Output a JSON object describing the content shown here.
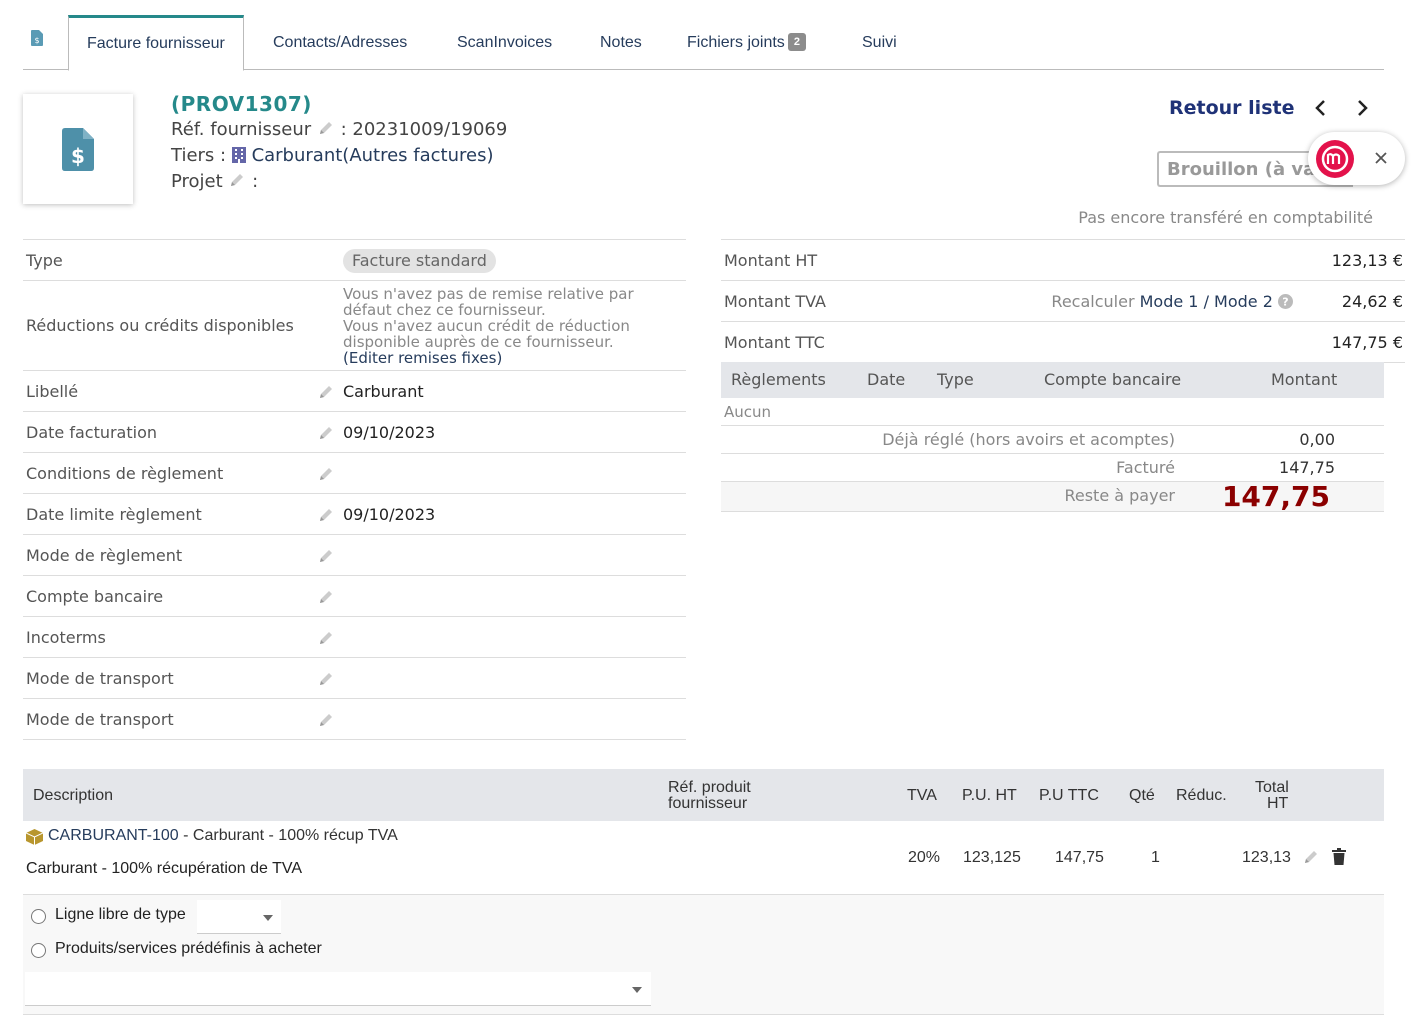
{
  "tabs": [
    {
      "label": "Facture fournisseur"
    },
    {
      "label": "Contacts/Adresses"
    },
    {
      "label": "ScanInvoices"
    },
    {
      "label": "Notes"
    },
    {
      "label": "Fichiers joints",
      "badge": "2"
    },
    {
      "label": "Suivi"
    }
  ],
  "header": {
    "ref": "(PROV1307)",
    "ref_fournisseur_label": "Réf. fournisseur",
    "ref_fournisseur_value": ": 20231009/19069",
    "tiers_label": "Tiers :",
    "tiers_name": "Carburant",
    "tiers_category": "Autres factures",
    "projet_label": "Projet",
    "projet_sep": ":",
    "retour_liste": "Retour liste",
    "status": "Brouillon (à valider)",
    "compta_status": "Pas encore transféré en comptabilité"
  },
  "fields": [
    {
      "label": "Type",
      "value": "Facture standard"
    },
    {
      "label": "Réductions ou crédits disponibles",
      "line1": "Vous n'avez pas de remise relative par défaut chez ce fournisseur.",
      "line2": "Vous n'avez aucun crédit de réduction disponible auprès de ce fournisseur.",
      "link": "Editer remises fixes"
    },
    {
      "label": "Libellé",
      "value": "Carburant"
    },
    {
      "label": "Date facturation",
      "value": "09/10/2023"
    },
    {
      "label": "Conditions de règlement",
      "value": ""
    },
    {
      "label": "Date limite règlement",
      "value": "09/10/2023"
    },
    {
      "label": "Mode de règlement",
      "value": ""
    },
    {
      "label": "Compte bancaire",
      "value": ""
    },
    {
      "label": "Incoterms",
      "value": ""
    },
    {
      "label": "Mode de transport",
      "value": ""
    },
    {
      "label": "Mode de transport",
      "value": ""
    }
  ],
  "totals": {
    "ht_label": "Montant HT",
    "ht_value": "123,13 €",
    "tva_label": "Montant TVA",
    "tva_value": "24,62 €",
    "recalc_label": "Recalculer",
    "mode1": "Mode 1",
    "mode_sep": "/",
    "mode2": "Mode 2",
    "ttc_label": "Montant TTC",
    "ttc_value": "147,75 €"
  },
  "payments": {
    "headers": [
      "Règlements",
      "Date",
      "Type",
      "Compte bancaire",
      "Montant"
    ],
    "none": "Aucun",
    "deja_label": "Déjà réglé (hors avoirs et acomptes)",
    "deja_value": "0,00",
    "facture_label": "Facturé",
    "facture_value": "147,75",
    "reste_label": "Reste à payer",
    "reste_value": "147,75"
  },
  "lines": {
    "headers": {
      "description": "Description",
      "ref_produit_1": "Réf. produit",
      "ref_produit_2": "fournisseur",
      "tva": "TVA",
      "pu_ht": "P.U. HT",
      "pu_ttc": "P.U TTC",
      "qte": "Qté",
      "reduc": "Réduc.",
      "total_1": "Total",
      "total_2": "HT"
    },
    "rows": [
      {
        "code": "CARBURANT-100",
        "title": " - Carburant - 100% récup TVA",
        "description": "Carburant - 100% récupération de TVA",
        "tva": "20%",
        "pu_ht": "123,125",
        "pu_ttc": "147,75",
        "qte": "1",
        "total": "123,13"
      }
    ],
    "add_free_line": "Ligne libre de type",
    "add_predefined": "Produits/services prédéfinis à acheter"
  },
  "colors": {
    "accent": "#25898a",
    "link": "#263c5c",
    "due": "#8b0000"
  }
}
